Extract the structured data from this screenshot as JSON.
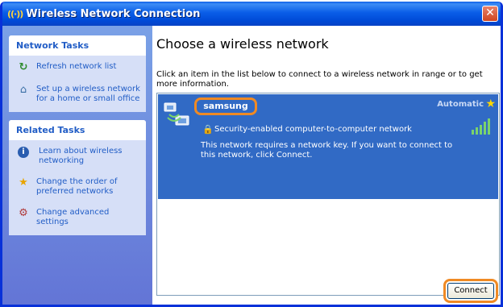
{
  "window": {
    "title": "Wireless Network Connection",
    "title_icon": "wireless-antenna-icon"
  },
  "sidebar": {
    "network_tasks": {
      "header": "Network Tasks",
      "items": [
        {
          "label": "Refresh network list",
          "icon": "refresh-icon"
        },
        {
          "label": "Set up a wireless network for a home or small office",
          "icon": "wireless-setup-icon"
        }
      ]
    },
    "related_tasks": {
      "header": "Related Tasks",
      "items": [
        {
          "label": "Learn about wireless networking",
          "icon": "info-icon"
        },
        {
          "label": "Change the order of preferred networks",
          "icon": "star-icon"
        },
        {
          "label": "Change advanced settings",
          "icon": "settings-icon"
        }
      ]
    }
  },
  "main": {
    "title": "Choose a wireless network",
    "description": "Click an item in the list below to connect to a wireless network in range or to get more information.",
    "network": {
      "name": "samsung",
      "mode": "Automatic",
      "security": "Security-enabled computer-to-computer network",
      "message": "This network requires a network key. If you want to connect to this network, click Connect.",
      "signal_strength": "5 of 5 bars"
    },
    "connect_label": "Connect"
  },
  "colors": {
    "selection": "#316ac5",
    "highlight_outline": "#f08a24",
    "title_bar": "#0a5ee8",
    "sidebar": "#6f8ee0",
    "link": "#215dc6"
  }
}
